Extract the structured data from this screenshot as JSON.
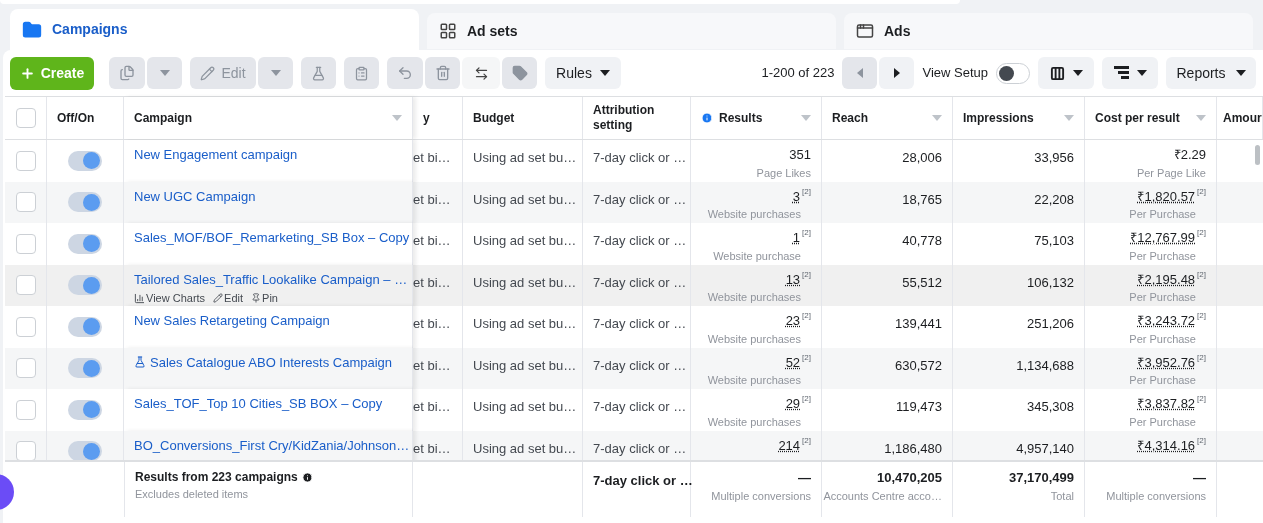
{
  "tabs": [
    {
      "label": "Campaigns",
      "selected": true,
      "kind": "campaigns"
    },
    {
      "label": "Ad sets",
      "selected": false,
      "kind": "adsets"
    },
    {
      "label": "Ads",
      "selected": false,
      "kind": "ads"
    }
  ],
  "toolbar": {
    "create": "Create",
    "edit": "Edit",
    "rules": "Rules",
    "pagination": "1-200 of 223",
    "view_setup": {
      "label": "View Setup",
      "on": false
    },
    "reports": "Reports"
  },
  "table": {
    "header_checked": false,
    "columns": [
      {
        "label": "Off/On",
        "menu": false,
        "info": false
      },
      {
        "label": "Campaign",
        "menu": true,
        "info": false
      },
      {
        "label": "y",
        "menu": false,
        "info": false
      },
      {
        "label": "Budget",
        "menu": false,
        "info": false
      },
      {
        "label": "Attribution setting",
        "menu": false,
        "info": false
      },
      {
        "label": "Results",
        "menu": true,
        "info": true
      },
      {
        "label": "Reach",
        "menu": true,
        "info": false
      },
      {
        "label": "Impressions",
        "menu": true,
        "info": false
      },
      {
        "label": "Cost per result",
        "menu": true,
        "info": false
      },
      {
        "label": "Amour",
        "menu": false,
        "info": false
      }
    ],
    "rows": [
      {
        "checked": false,
        "on": true,
        "test": false,
        "hovered": false,
        "name": "New Engagement campaign",
        "column_3": "et bi…",
        "budget": "Using ad set bu…",
        "attribution": "7-day click or …",
        "results": {
          "value": "351",
          "label": "Page Likes"
        },
        "reach": "28,006",
        "impressions": "33,956",
        "cost": {
          "value": "₹2.29",
          "label": "Per Page Like"
        }
      },
      {
        "checked": false,
        "on": true,
        "test": false,
        "hovered": false,
        "name": "New UGC Campaign",
        "column_3": "et bi…",
        "budget": "Using ad set bu…",
        "attribution": "7-day click or …",
        "results": {
          "value": "3",
          "note": "[2]",
          "label": "Website purchases"
        },
        "reach": "18,765",
        "impressions": "22,208",
        "cost": {
          "value": "₹1,820.57",
          "note": "[2]",
          "label": "Per Purchase"
        }
      },
      {
        "checked": false,
        "on": true,
        "test": false,
        "hovered": false,
        "name": "Sales_MOF/BOF_Remarketing_SB Box – Copy",
        "column_3": "et bi…",
        "budget": "Using ad set bu…",
        "attribution": "7-day click or …",
        "results": {
          "value": "1",
          "note": "[2]",
          "label": "Website purchase"
        },
        "reach": "40,778",
        "impressions": "75,103",
        "cost": {
          "value": "₹12,767.99",
          "note": "[2]",
          "label": "Per Purchase"
        }
      },
      {
        "checked": false,
        "on": true,
        "test": false,
        "hovered": true,
        "name": "Tailored Sales_Traffic Lookalike Campaign – …",
        "actions": [
          {
            "kind": "chart",
            "label": "View Charts"
          },
          {
            "kind": "edit",
            "label": "Edit"
          },
          {
            "kind": "pin",
            "label": "Pin"
          }
        ],
        "column_3": "et bi…",
        "budget": "Using ad set bu…",
        "attribution": "7-day click or …",
        "results": {
          "value": "13",
          "note": "[2]",
          "label": "Website purchases"
        },
        "reach": "55,512",
        "impressions": "106,132",
        "cost": {
          "value": "₹2,195.48",
          "note": "[2]",
          "label": "Per Purchase"
        }
      },
      {
        "checked": false,
        "on": true,
        "test": false,
        "hovered": false,
        "name": "New Sales Retargeting Campaign",
        "column_3": "et bi…",
        "budget": "Using ad set bu…",
        "attribution": "7-day click or …",
        "results": {
          "value": "23",
          "note": "[2]",
          "label": "Website purchases"
        },
        "reach": "139,441",
        "impressions": "251,206",
        "cost": {
          "value": "₹3,243.72",
          "note": "[2]",
          "label": "Per Purchase"
        }
      },
      {
        "checked": false,
        "on": true,
        "test": true,
        "hovered": false,
        "name": "Sales Catalogue ABO Interests Campaign",
        "column_3": "et bi…",
        "budget": "Using ad set bu…",
        "attribution": "7-day click or …",
        "results": {
          "value": "52",
          "note": "[2]",
          "label": "Website purchases"
        },
        "reach": "630,572",
        "impressions": "1,134,688",
        "cost": {
          "value": "₹3,952.76",
          "note": "[2]",
          "label": "Per Purchase"
        }
      },
      {
        "checked": false,
        "on": true,
        "test": false,
        "hovered": false,
        "name": "Sales_TOF_Top 10 Cities_SB BOX – Copy",
        "column_3": "et bi…",
        "budget": "Using ad set bu…",
        "attribution": "7-day click or …",
        "results": {
          "value": "29",
          "note": "[2]",
          "label": "Website purchases"
        },
        "reach": "119,473",
        "impressions": "345,308",
        "cost": {
          "value": "₹3,837.82",
          "note": "[2]",
          "label": "Per Purchase"
        }
      },
      {
        "checked": false,
        "on": true,
        "test": false,
        "hovered": false,
        "name": "BO_Conversions_First Cry/KidZania/Johnson…",
        "column_3": "et bi…",
        "budget": "Using ad set bu…",
        "attribution": "7-day click or …",
        "results": {
          "value": "214",
          "note": "[2]"
        },
        "reach": "1,186,480",
        "impressions": "4,957,140",
        "cost": {
          "value": "₹4,314.16",
          "note": "[2]"
        }
      }
    ],
    "totals": {
      "title": "Results from 223 campaigns",
      "subtitle": "Excludes deleted items",
      "attribution": "7-day click or …",
      "results": {
        "value": "—",
        "label": "Multiple conversions"
      },
      "reach": {
        "value": "10,470,205",
        "label": "Accounts Centre acco…"
      },
      "impressions": {
        "value": "37,170,499",
        "label": "Total"
      },
      "cost": {
        "value": "—",
        "label": "Multiple conversions"
      }
    }
  }
}
